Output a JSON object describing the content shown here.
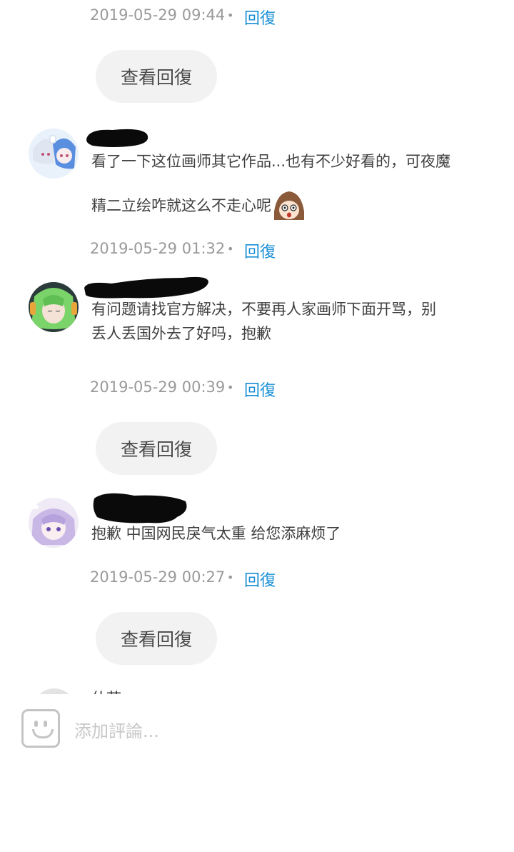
{
  "comments": [
    {
      "timestamp": "2019-05-29 09:44",
      "separator": "•",
      "reply_label": "回復",
      "view_replies": "查看回復"
    },
    {
      "text_line1": "看了一下这位画师其它作品...也有不少好看的，可夜魔",
      "text_line2": "精二立绘咋就这么不走心呢",
      "timestamp": "2019-05-29 01:32",
      "separator": "•",
      "reply_label": "回復"
    },
    {
      "text_line1": "有问题请找官方解决，不要再人家画师下面开骂，别",
      "text_line2": "丢人丢国外去了好吗，抱歉",
      "timestamp": "2019-05-29 00:39",
      "separator": "•",
      "reply_label": "回復",
      "view_replies": "查看回復"
    },
    {
      "text_line1": "抱歉 中国网民戾气太重 给您添麻烦了",
      "timestamp": "2019-05-29 00:27",
      "separator": "•",
      "reply_label": "回復",
      "view_replies": "查看回復"
    }
  ],
  "partial_name": "什荭",
  "composer": {
    "placeholder": "添加評論..."
  },
  "colors": {
    "accent": "#1a8fd6",
    "meta": "#9a9a9a",
    "button_bg": "#f2f2f2"
  }
}
